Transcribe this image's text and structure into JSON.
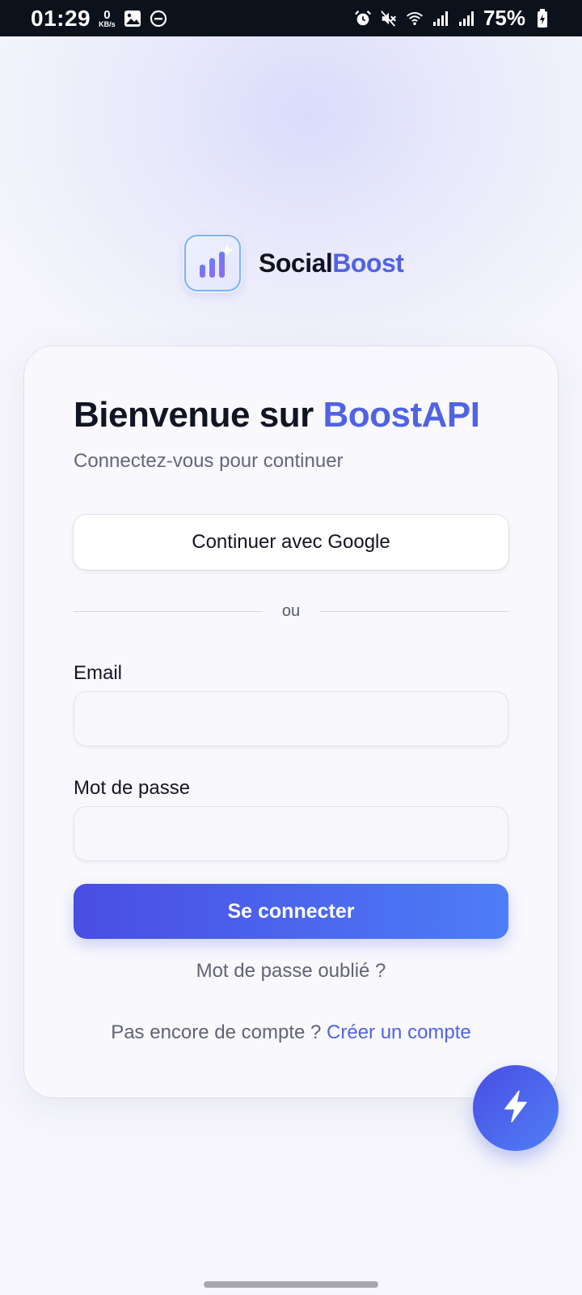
{
  "status_bar": {
    "time": "01:29",
    "net_speed_value": "0",
    "net_speed_unit": "KB/s",
    "battery": "75%"
  },
  "brand": {
    "name_part1": "Social",
    "name_part2": "Boost",
    "logo_icon": "bar-chart-sparkle-icon",
    "accent_color": "#4f63e4"
  },
  "login": {
    "title_prefix": "Bienvenue sur ",
    "title_accent": "BoostAPI",
    "subtitle": "Connectez-vous pour continuer",
    "google_button": "Continuer avec Google",
    "divider_text": "ou",
    "email_label": "Email",
    "email_value": "",
    "password_label": "Mot de passe",
    "password_value": "",
    "submit_button": "Se connecter",
    "forgot_link": "Mot de passe oublié ?",
    "signup_prompt": "Pas encore de compte ? ",
    "signup_link": "Créer un compte"
  },
  "fab": {
    "icon": "lightning-bolt-icon"
  },
  "colors": {
    "primary_start": "#4a4de3",
    "primary_end": "#4d7df7",
    "status_bar_bg": "#0b121c"
  }
}
